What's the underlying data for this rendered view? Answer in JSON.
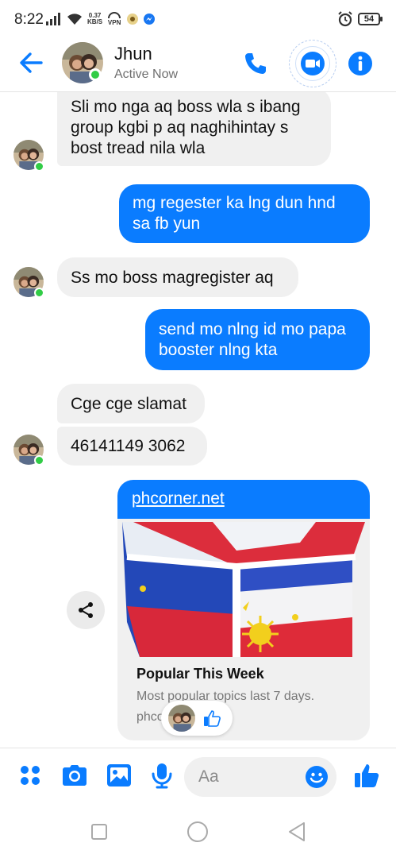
{
  "status_bar": {
    "time": "8:22",
    "net_speed_value": "0.37",
    "net_speed_unit": "KB/S",
    "vpn_label": "VPN",
    "battery": "54"
  },
  "header": {
    "contact_name": "Jhun",
    "contact_status": "Active Now",
    "accent_color": "#0a7cff",
    "online_color": "#31cc46"
  },
  "messages": [
    {
      "direction": "incoming",
      "text": "Sli mo nga aq boss wla s ibang group kgbi p aq naghihintay s bost tread nila wla"
    },
    {
      "direction": "outgoing",
      "text": "mg regester ka lng dun hnd sa fb yun"
    },
    {
      "direction": "incoming",
      "text": "Ss mo boss magregister aq"
    },
    {
      "direction": "outgoing",
      "text": "send mo nlng id mo papa booster nlng kta"
    },
    {
      "direction": "incoming",
      "text": "Cge cge slamat"
    },
    {
      "direction": "incoming",
      "text": "46141149 3062"
    }
  ],
  "link_preview": {
    "url_text": "phcorner.net",
    "title": "Popular This Week",
    "description": "Most popular topics last 7 days.",
    "domain": "phcorner.net",
    "image_subject": "philippine-flag-cube",
    "reaction": "like"
  },
  "composer": {
    "placeholder": "Aa",
    "icons": [
      "apps-icon",
      "camera-icon",
      "gallery-icon",
      "microphone-icon",
      "emoji-icon",
      "like-icon"
    ]
  },
  "nav_bar": {
    "icons": [
      "recents-icon",
      "home-icon",
      "back-icon"
    ]
  }
}
